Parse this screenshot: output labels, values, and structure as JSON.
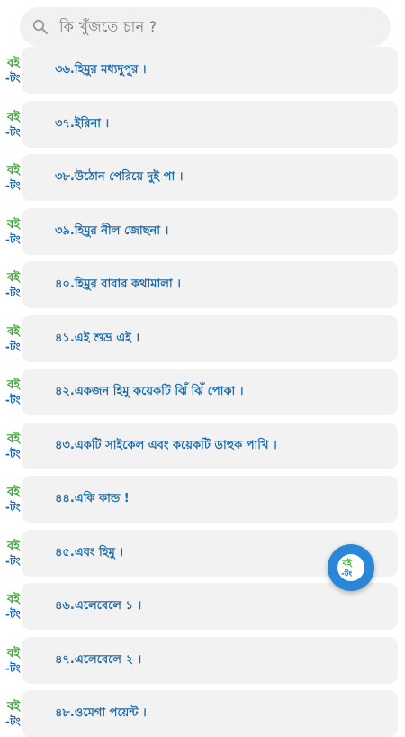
{
  "search": {
    "placeholder": "কি খুঁজতে চান ?"
  },
  "logo": {
    "top_text": "বই",
    "bottom_text": "-টং"
  },
  "items": [
    {
      "label": "৩৬.হিমুর মধ্যদুপুর ।"
    },
    {
      "label": "৩৭.ইরিনা ।"
    },
    {
      "label": "৩৮.উঠোন পেরিয়ে দুই পা ।"
    },
    {
      "label": "৩৯.হিমুর নীল জোছনা ।"
    },
    {
      "label": "৪০.হিমুর বাবার কথামালা ।"
    },
    {
      "label": "৪১.এই শুভ্র এই ।"
    },
    {
      "label": "৪২.একজন হিমু কয়েকটি ঝিঁ ঝিঁ পোকা ।"
    },
    {
      "label": "৪৩.একটি সাইকেল এবং কয়েকটি ডাহুক পাখি ।"
    },
    {
      "label": "৪৪.একি কান্ড !"
    },
    {
      "label": "৪৫.এবং হিমু ।"
    },
    {
      "label": "৪৬.এলেবেলে ১ ।"
    },
    {
      "label": "৪৭.এলেবেলে ২ ।"
    },
    {
      "label": "৪৮.ওমেগা পয়েন্ট ।"
    }
  ],
  "colors": {
    "accent": "#1f6aa5",
    "fab": "#2a87d8",
    "logo_green": "#3aa935",
    "logo_blue": "#1b5fa8"
  }
}
